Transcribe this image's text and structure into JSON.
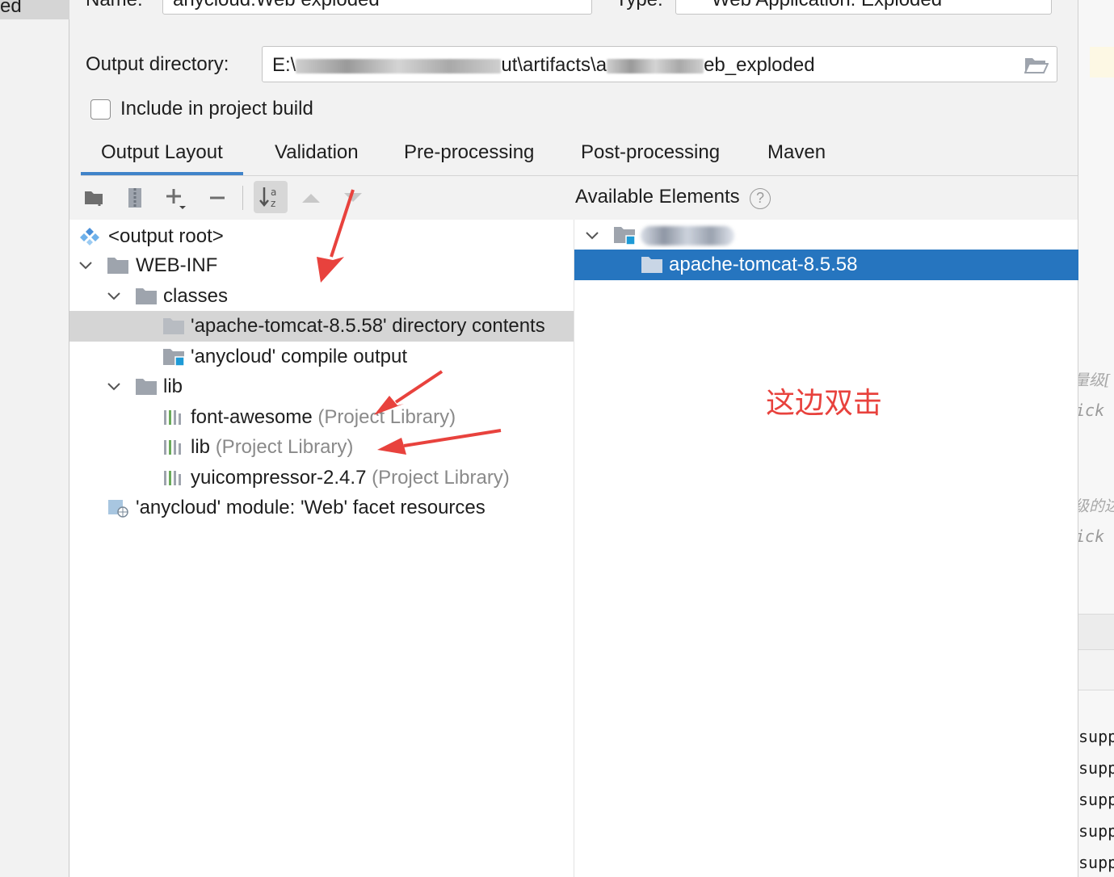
{
  "outside": {
    "left_text": "ed",
    "right_code_lines": [
      "ick",
      "ick"
    ],
    "right_cn_lines": [
      "量级[",
      "级的达"
    ],
    "right_sup_lines": [
      "supp",
      "supp",
      "supp",
      "supp",
      "supp"
    ]
  },
  "form": {
    "name_label": "Name:",
    "name_value": "anycloud:Web exploded",
    "type_label": "Type:",
    "type_value": "Web Application: Exploded",
    "output_dir_label": "Output directory:",
    "output_dir_prefix": "E:\\",
    "output_dir_mid1": "ut\\artifacts\\a",
    "output_dir_suffix": "eb_exploded",
    "include_label": "Include in project build",
    "include_checked": false
  },
  "tabs": [
    {
      "label": "Output Layout",
      "active": true
    },
    {
      "label": "Validation",
      "active": false
    },
    {
      "label": "Pre-processing",
      "active": false
    },
    {
      "label": "Post-processing",
      "active": false
    },
    {
      "label": "Maven",
      "active": false
    }
  ],
  "toolbar": {
    "icons": [
      "new-directory-icon",
      "archive-icon",
      "add-icon",
      "remove-icon",
      "sort-icon",
      "move-up-icon",
      "move-down-icon"
    ]
  },
  "tree": {
    "output_root": "<output root>",
    "web_inf": "WEB-INF",
    "classes": "classes",
    "tomcat_contents": "'apache-tomcat-8.5.58' directory contents",
    "compile_output": "'anycloud' compile output",
    "lib": "lib",
    "font_awesome": "font-awesome",
    "font_awesome_tag": "(Project Library)",
    "lib_item": "lib",
    "lib_item_tag": "(Project Library)",
    "yuicompressor": "yuicompressor-2.4.7",
    "yuicompressor_tag": "(Project Library)",
    "facet": "'anycloud' module: 'Web' facet resources"
  },
  "available": {
    "title": "Available Elements",
    "help": "?",
    "selected_item": "apache-tomcat-8.5.58"
  },
  "annotation": "这边双击",
  "colors": {
    "selection_blue": "#2675bf",
    "tab_underline": "#4083c9",
    "annotation_red": "#e8423d"
  }
}
